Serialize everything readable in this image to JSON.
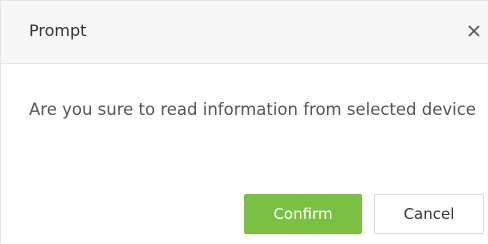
{
  "dialog": {
    "title": "Prompt",
    "close_icon": "close-icon",
    "message": "Are you sure to read information from selected device",
    "buttons": {
      "confirm_label": "Confirm",
      "cancel_label": "Cancel"
    }
  },
  "colors": {
    "header_bg": "#f7f7f7",
    "confirm_bg": "#7ac143",
    "confirm_text": "#ffffff",
    "cancel_border": "#d9d9d9",
    "text": "#555555"
  }
}
